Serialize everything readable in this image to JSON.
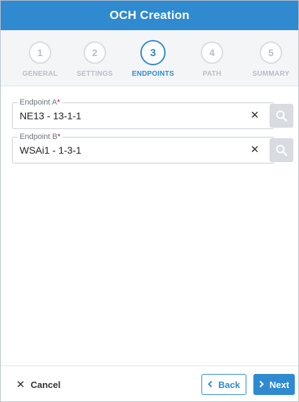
{
  "dialog": {
    "title": "OCH Creation"
  },
  "stepper": {
    "active_color": "#2f8ad0",
    "inactive_color": "#b7bec7",
    "steps": [
      {
        "number": "1",
        "label": "GENERAL",
        "state": "inactive"
      },
      {
        "number": "2",
        "label": "SETTINGS",
        "state": "inactive"
      },
      {
        "number": "3",
        "label": "ENDPOINTS",
        "state": "active"
      },
      {
        "number": "4",
        "label": "PATH",
        "state": "inactive"
      },
      {
        "number": "5",
        "label": "SUMMARY",
        "state": "inactive"
      }
    ]
  },
  "endpoint_a": {
    "label": "Endpoint A",
    "required_mark": "*",
    "value": "NE13 - 13-1-1",
    "clear_icon": "close-icon",
    "search_icon": "search-icon"
  },
  "endpoint_b": {
    "label": "Endpoint B",
    "required_mark": "*",
    "value": "WSAi1 - 1-3-1",
    "clear_icon": "close-icon",
    "search_icon": "search-icon"
  },
  "footer": {
    "cancel_label": "Cancel",
    "back_label": "Back",
    "next_label": "Next"
  }
}
